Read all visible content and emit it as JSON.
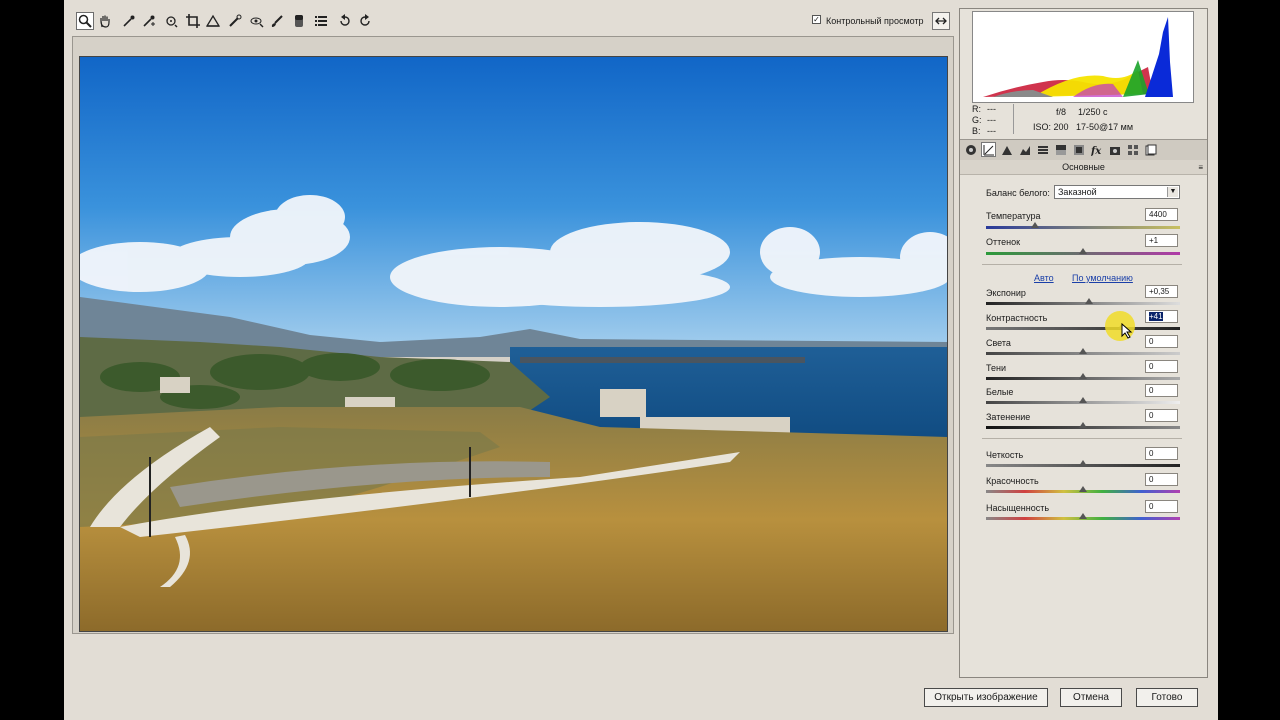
{
  "toolbar": {
    "tools": [
      "zoom-icon",
      "hand-icon",
      "white-balance-icon",
      "color-sampler-icon",
      "target-adjust-icon",
      "crop-icon",
      "straighten-icon",
      "spot-removal-icon",
      "red-eye-icon",
      "adjustment-brush-icon",
      "graduated-filter-icon",
      "preferences-icon",
      "rotate-left-icon",
      "rotate-right-icon"
    ],
    "preview_label": "Контрольный просмотр",
    "preview_checked": true
  },
  "info": {
    "r_label": "R:",
    "r_value": "---",
    "g_label": "G:",
    "g_value": "---",
    "b_label": "B:",
    "b_value": "---",
    "aperture": "f/8",
    "shutter": "1/250 с",
    "iso": "ISO: 200",
    "lens": "17-50@17 мм"
  },
  "panel": {
    "section_title": "Основные",
    "white_balance_label": "Баланс белого:",
    "white_balance_value": "Заказной",
    "auto_link": "Авто",
    "default_link": "По умолчанию",
    "sliders": {
      "temperature": {
        "label": "Температура",
        "value": "4400",
        "level": 0.25
      },
      "tint": {
        "label": "Оттенок",
        "value": "+1",
        "level": 0.5
      },
      "exposure": {
        "label": "Экспонир",
        "value": "+0,35",
        "level": 0.53
      },
      "contrast": {
        "label": "Контрастность",
        "value": "+41",
        "level": 0.7
      },
      "highlights": {
        "label": "Света",
        "value": "0",
        "level": 0.5
      },
      "shadows": {
        "label": "Тени",
        "value": "0",
        "level": 0.5
      },
      "whites": {
        "label": "Белые",
        "value": "0",
        "level": 0.5
      },
      "blacks": {
        "label": "Затенение",
        "value": "0",
        "level": 0.5
      },
      "clarity": {
        "label": "Четкость",
        "value": "0",
        "level": 0.5
      },
      "vibrance": {
        "label": "Красочность",
        "value": "0",
        "level": 0.5
      },
      "saturation": {
        "label": "Насыщенность",
        "value": "0",
        "level": 0.5
      }
    }
  },
  "buttons": {
    "open": "Открыть изображение",
    "cancel": "Отмена",
    "done": "Готово"
  },
  "colors": {
    "accent_highlight": "#0a246a",
    "link": "#1a3fa8"
  }
}
